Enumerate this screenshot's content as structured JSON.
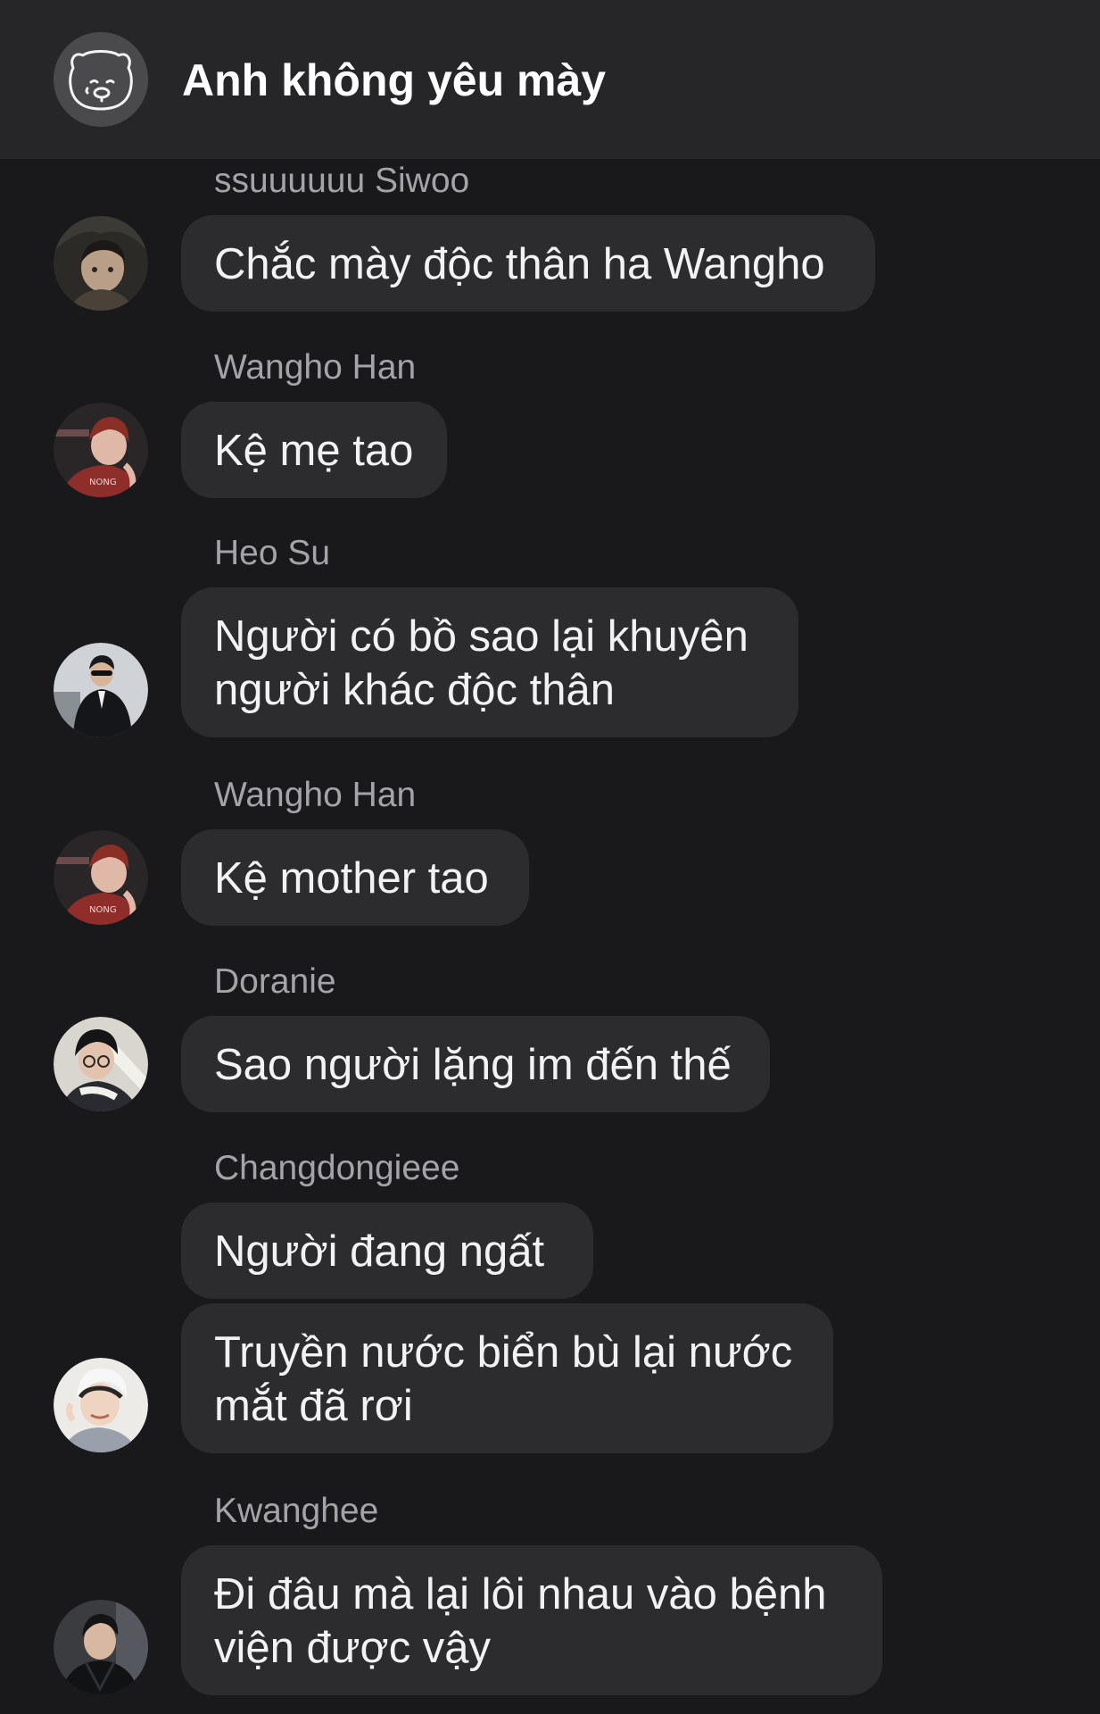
{
  "conversation": {
    "title": "Anh không yêu mày"
  },
  "messages": [
    {
      "sender": "ssuuuuuu Siwoo",
      "texts": [
        "Chắc mày độc thân ha Wangho"
      ]
    },
    {
      "sender": "Wangho Han",
      "texts": [
        "Kệ mẹ tao"
      ]
    },
    {
      "sender": "Heo Su",
      "texts": [
        "Người có bồ sao lại khuyên người khác độc thân"
      ]
    },
    {
      "sender": "Wangho Han",
      "texts": [
        "Kệ mother tao"
      ]
    },
    {
      "sender": "Doranie",
      "texts": [
        "Sao người lặng im đến thế"
      ]
    },
    {
      "sender": "Changdongieee",
      "texts": [
        "Người đang ngất",
        "Truyền nước biển bù lại nước mắt đã rơi"
      ]
    },
    {
      "sender": "Kwanghee",
      "texts": [
        "Đi đâu mà lại lôi nhau vào bệnh viện được vậy"
      ]
    }
  ],
  "colors": {
    "background": "#19191b",
    "header": "#262628",
    "bubble": "#2c2c2e",
    "message_text": "#f2f2f4",
    "sender_text": "#a4a4a8"
  },
  "icons": {
    "group_avatar": "bear-face-icon"
  }
}
